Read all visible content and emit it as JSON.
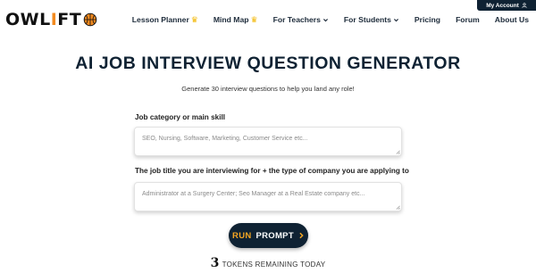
{
  "account": {
    "label": "My Account"
  },
  "logo": {
    "text_left": "OWL",
    "text_mid": "I",
    "text_right": "FT"
  },
  "nav": {
    "items": [
      {
        "label": "Lesson Planner",
        "crown": true
      },
      {
        "label": "Mind Map",
        "crown": true
      },
      {
        "label": "For Teachers",
        "dropdown": true
      },
      {
        "label": "For Students",
        "dropdown": true
      },
      {
        "label": "Pricing"
      },
      {
        "label": "Forum"
      },
      {
        "label": "About Us"
      }
    ]
  },
  "main": {
    "title": "AI JOB INTERVIEW QUESTION GENERATOR",
    "subtitle": "Generate 30 interview questions to help you land any role!",
    "field1": {
      "label": "Job category or main skill",
      "placeholder": "SEO, Nursing, Software, Marketing, Customer Service etc..."
    },
    "field2": {
      "label": "The job title you are interviewing for + the type of company you are applying to",
      "placeholder": "Administrator at a Surgery Center; Seo Manager at a Real Estate company etc..."
    },
    "run_button": {
      "run": "RUN",
      "prompt": "PROMPT"
    },
    "tokens": {
      "count": "3",
      "text": "TOKENS REMAINING TODAY"
    }
  },
  "colors": {
    "navy": "#0f2233",
    "orange": "#f5a623",
    "crown": "#f2b600"
  }
}
